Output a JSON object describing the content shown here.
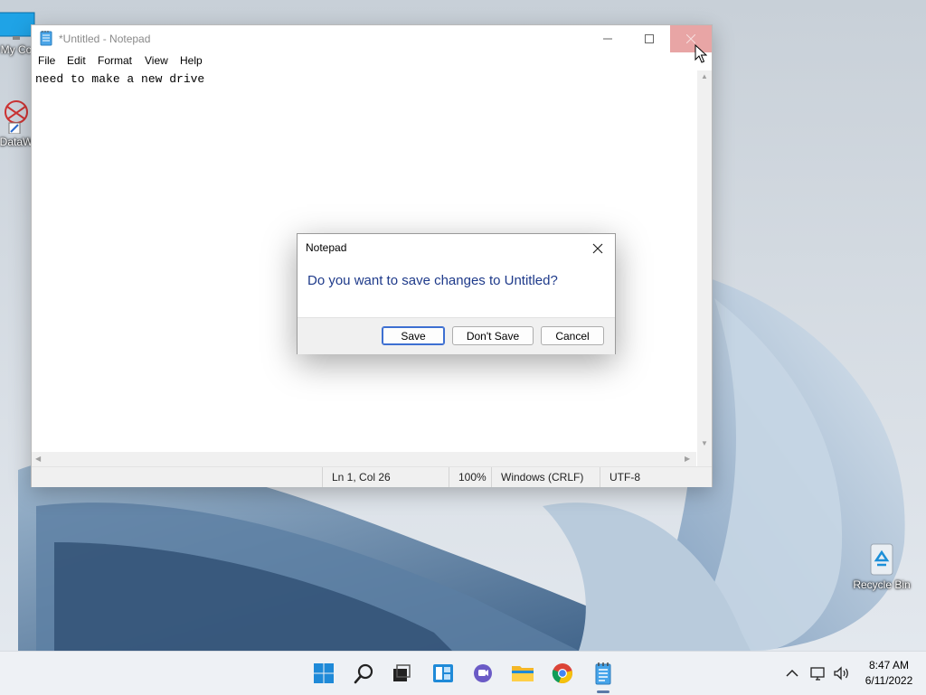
{
  "desktop": {
    "icons": [
      {
        "label": "My Co",
        "icon": "computer-icon"
      },
      {
        "label": "DataW",
        "icon": "datawarrior-icon"
      },
      {
        "label": "Recycle Bin",
        "icon": "recycle-bin-icon"
      }
    ]
  },
  "notepad": {
    "title": "*Untitled - Notepad",
    "menu": [
      "File",
      "Edit",
      "Format",
      "View",
      "Help"
    ],
    "content": "need to make a new drive",
    "status": {
      "position": "Ln 1, Col 26",
      "zoom": "100%",
      "line_ending": "Windows (CRLF)",
      "encoding": "UTF-8"
    }
  },
  "dialog": {
    "title": "Notepad",
    "message": "Do you want to save changes to Untitled?",
    "buttons": {
      "save": "Save",
      "dont_save": "Don't Save",
      "cancel": "Cancel"
    }
  },
  "taskbar": {
    "apps": [
      "start-icon",
      "search-icon",
      "task-view-icon",
      "widgets-icon",
      "chat-icon",
      "file-explorer-icon",
      "chrome-icon",
      "notepad-icon"
    ],
    "clock": {
      "time": "8:47 AM",
      "date": "6/11/2022"
    }
  },
  "colors": {
    "accent": "#3d6fd1",
    "dialog_message": "#1e3a8a",
    "close_hover": "#e8a5a5"
  }
}
